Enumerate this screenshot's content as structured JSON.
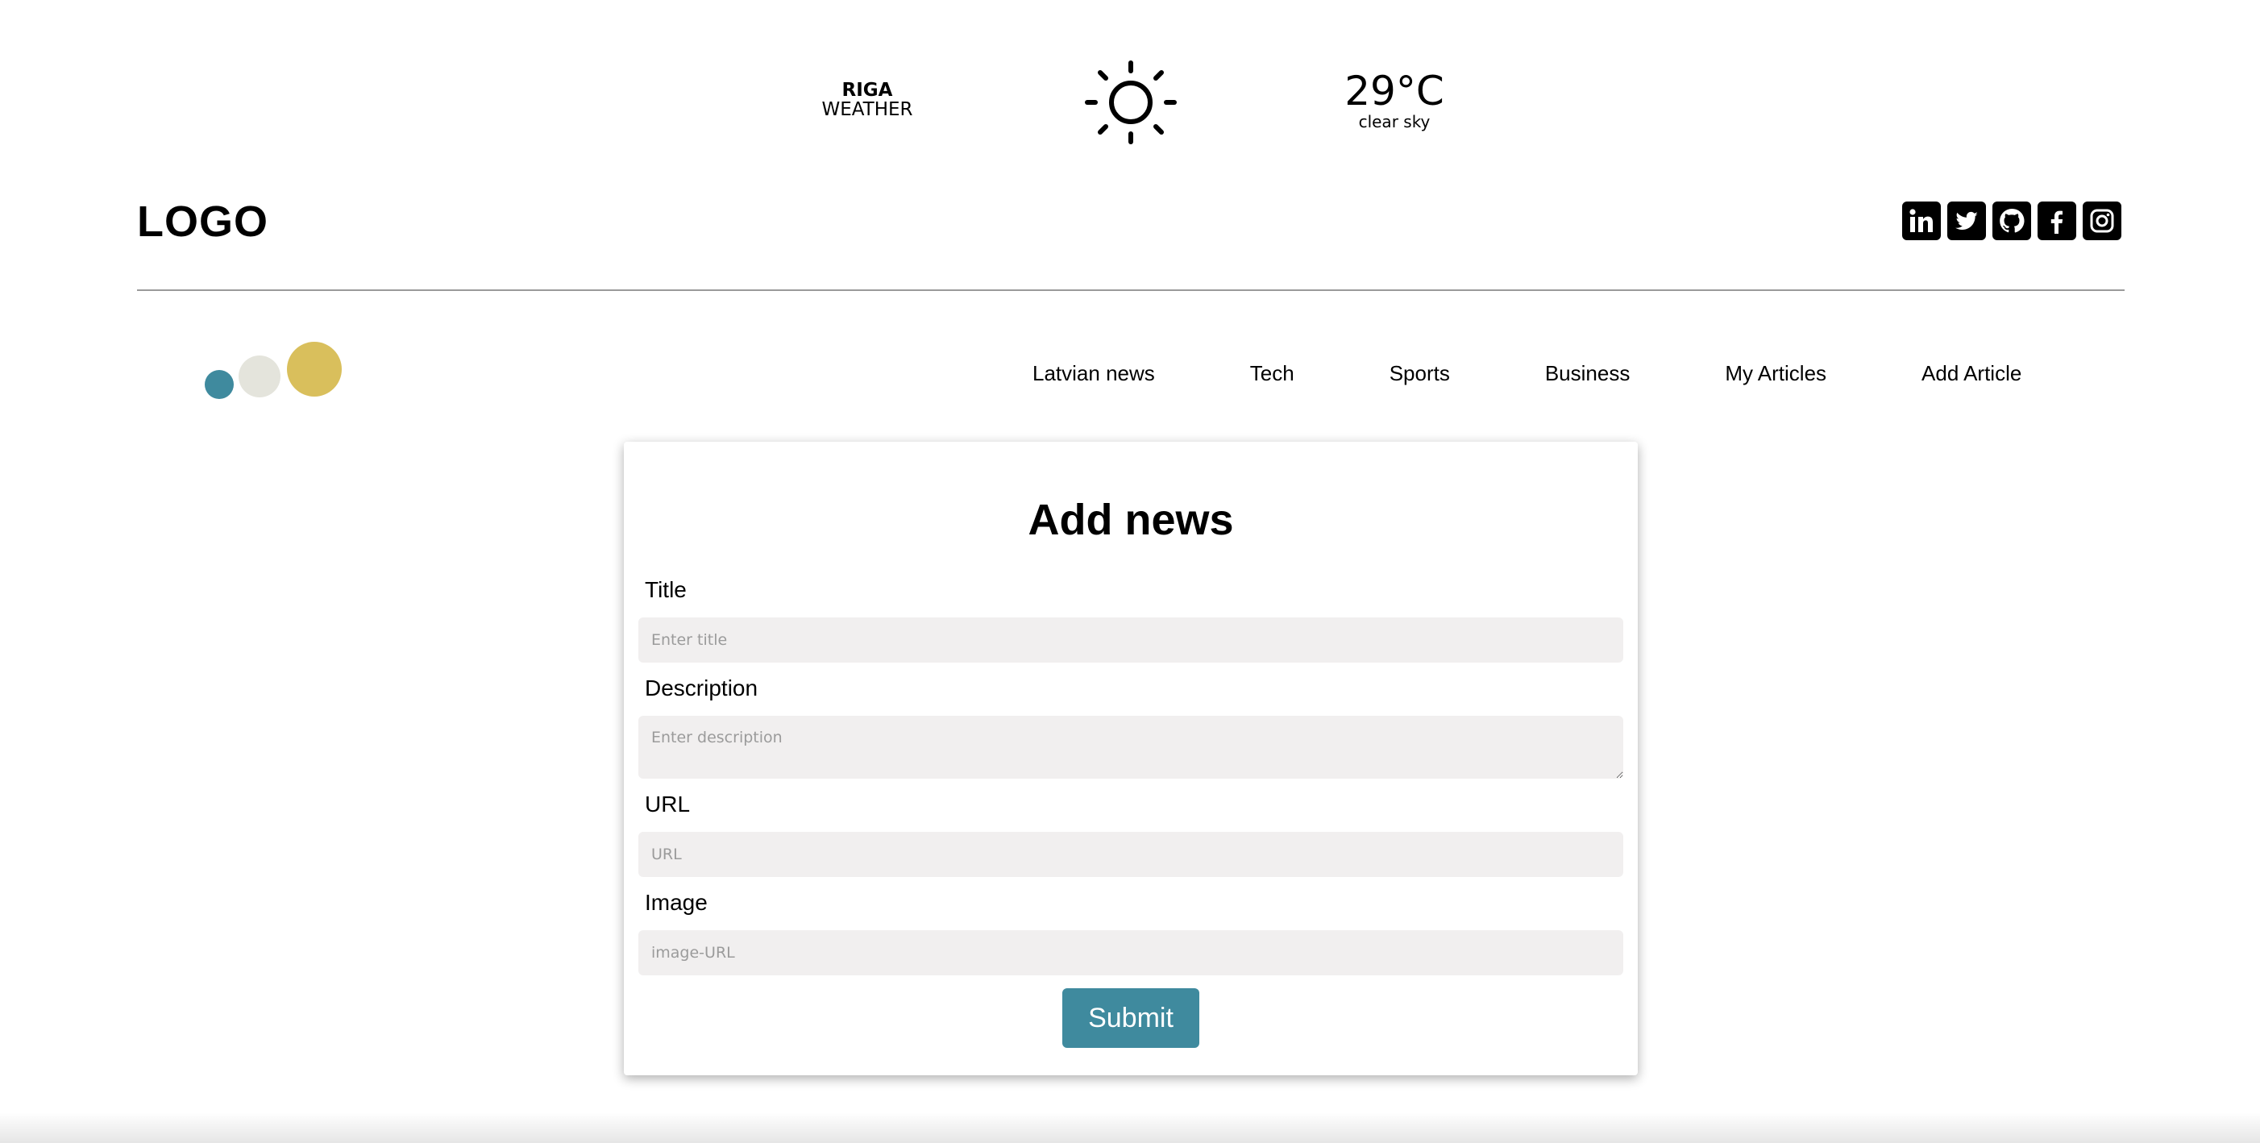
{
  "weather": {
    "city": "RIGA",
    "label": "WEATHER",
    "icon": "sun-icon",
    "temperature": "29°C",
    "description": "clear sky"
  },
  "header": {
    "logo": "LOGO",
    "socials": [
      {
        "name": "linkedin-icon",
        "glyph": "in"
      },
      {
        "name": "twitter-icon"
      },
      {
        "name": "github-icon"
      },
      {
        "name": "facebook-icon",
        "glyph": "f"
      },
      {
        "name": "instagram-icon"
      }
    ]
  },
  "decor": {
    "dot_colors": [
      "#3f8a9e",
      "#e4e4dc",
      "#d9bf5c"
    ]
  },
  "nav": {
    "items": [
      {
        "label": "Latvian news"
      },
      {
        "label": "Tech"
      },
      {
        "label": "Sports"
      },
      {
        "label": "Business"
      },
      {
        "label": "My Articles"
      },
      {
        "label": "Add Article"
      }
    ]
  },
  "form": {
    "heading": "Add news",
    "title": {
      "label": "Title",
      "placeholder": "Enter title",
      "value": ""
    },
    "description": {
      "label": "Description",
      "placeholder": "Enter description",
      "value": ""
    },
    "url": {
      "label": "URL",
      "placeholder": "URL",
      "value": ""
    },
    "image": {
      "label": "Image",
      "placeholder": "image-URL",
      "value": ""
    },
    "submit_label": "Submit",
    "accent_color": "#3f8a9e"
  }
}
